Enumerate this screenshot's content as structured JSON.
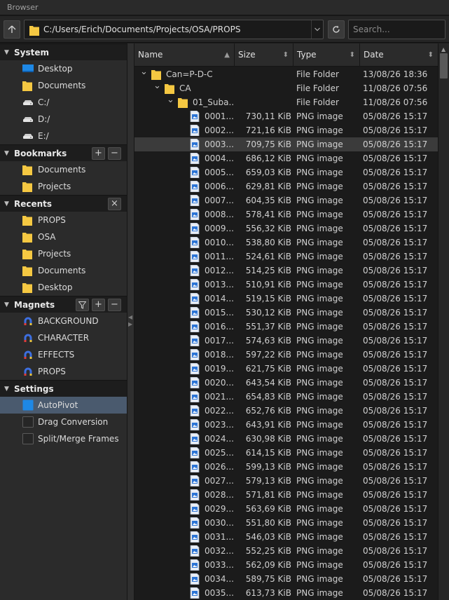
{
  "window": {
    "title": "Browser"
  },
  "toolbar": {
    "path": "C:/Users/Erich/Documents/Projects/OSA/PROPS",
    "search_placeholder": "Search..."
  },
  "sidebar": {
    "sections": [
      {
        "title": "System",
        "buttons": [],
        "items": [
          {
            "label": "Desktop",
            "icon": "desktop-icon"
          },
          {
            "label": "Documents",
            "icon": "folder-icon"
          },
          {
            "label": "C:/",
            "icon": "drive-icon"
          },
          {
            "label": "D:/",
            "icon": "drive-icon"
          },
          {
            "label": "E:/",
            "icon": "drive-icon"
          }
        ]
      },
      {
        "title": "Bookmarks",
        "buttons": [
          "+",
          "−"
        ],
        "items": [
          {
            "label": "Documents",
            "icon": "folder-icon"
          },
          {
            "label": "Projects",
            "icon": "folder-icon"
          }
        ]
      },
      {
        "title": "Recents",
        "buttons": [
          "×"
        ],
        "items": [
          {
            "label": "PROPS",
            "icon": "folder-icon"
          },
          {
            "label": "OSA",
            "icon": "folder-icon"
          },
          {
            "label": "Projects",
            "icon": "folder-icon"
          },
          {
            "label": "Documents",
            "icon": "folder-icon"
          },
          {
            "label": "Desktop",
            "icon": "folder-icon"
          }
        ]
      },
      {
        "title": "Magnets",
        "buttons": [
          "filter",
          "+",
          "−"
        ],
        "items": [
          {
            "label": "BACKGROUND",
            "icon": "magnet-icon"
          },
          {
            "label": "CHARACTER",
            "icon": "magnet-icon"
          },
          {
            "label": "EFFECTS",
            "icon": "magnet-icon"
          },
          {
            "label": "PROPS",
            "icon": "magnet-icon"
          }
        ]
      },
      {
        "title": "Settings",
        "buttons": [],
        "items": [
          {
            "label": "AutoPivot",
            "icon": "checkbox-icon",
            "checked": true,
            "selected": true
          },
          {
            "label": "Drag Conversion",
            "icon": "checkbox-icon",
            "checked": false
          },
          {
            "label": "Split/Merge Frames",
            "icon": "checkbox-icon",
            "checked": false
          }
        ]
      }
    ]
  },
  "columns": [
    {
      "label": "Name"
    },
    {
      "label": "Size"
    },
    {
      "label": "Type"
    },
    {
      "label": "Date"
    }
  ],
  "tree": [
    {
      "name": "Can=P-D-C",
      "size": "",
      "type": "File Folder",
      "date": "13/08/26 18:36",
      "level": 0,
      "icon": "folder-icon",
      "expanded": true
    },
    {
      "name": "CA",
      "size": "",
      "type": "File Folder",
      "date": "11/08/26 07:56",
      "level": 1,
      "icon": "folder-icon",
      "expanded": true
    },
    {
      "name": "01_Suba...",
      "size": "",
      "type": "File Folder",
      "date": "11/08/26 07:56",
      "level": 2,
      "icon": "folder-icon",
      "expanded": true
    }
  ],
  "files": [
    {
      "name": "0001...",
      "size": "730,11 KiB"
    },
    {
      "name": "0002...",
      "size": "721,16 KiB"
    },
    {
      "name": "0003...",
      "size": "709,75 KiB",
      "selected": true
    },
    {
      "name": "0004...",
      "size": "686,12 KiB"
    },
    {
      "name": "0005...",
      "size": "659,03 KiB"
    },
    {
      "name": "0006...",
      "size": "629,81 KiB"
    },
    {
      "name": "0007...",
      "size": "604,35 KiB"
    },
    {
      "name": "0008...",
      "size": "578,41 KiB"
    },
    {
      "name": "0009...",
      "size": "556,32 KiB"
    },
    {
      "name": "0010...",
      "size": "538,80 KiB"
    },
    {
      "name": "0011...",
      "size": "524,61 KiB"
    },
    {
      "name": "0012...",
      "size": "514,25 KiB"
    },
    {
      "name": "0013...",
      "size": "510,91 KiB"
    },
    {
      "name": "0014...",
      "size": "519,15 KiB"
    },
    {
      "name": "0015...",
      "size": "530,12 KiB"
    },
    {
      "name": "0016...",
      "size": "551,37 KiB"
    },
    {
      "name": "0017...",
      "size": "574,63 KiB"
    },
    {
      "name": "0018...",
      "size": "597,22 KiB"
    },
    {
      "name": "0019...",
      "size": "621,75 KiB"
    },
    {
      "name": "0020...",
      "size": "643,54 KiB"
    },
    {
      "name": "0021...",
      "size": "654,83 KiB"
    },
    {
      "name": "0022...",
      "size": "652,76 KiB"
    },
    {
      "name": "0023...",
      "size": "643,91 KiB"
    },
    {
      "name": "0024...",
      "size": "630,98 KiB"
    },
    {
      "name": "0025...",
      "size": "614,15 KiB"
    },
    {
      "name": "0026...",
      "size": "599,13 KiB"
    },
    {
      "name": "0027...",
      "size": "579,13 KiB"
    },
    {
      "name": "0028...",
      "size": "571,81 KiB"
    },
    {
      "name": "0029...",
      "size": "563,69 KiB"
    },
    {
      "name": "0030...",
      "size": "551,80 KiB"
    },
    {
      "name": "0031...",
      "size": "546,03 KiB"
    },
    {
      "name": "0032...",
      "size": "552,25 KiB"
    },
    {
      "name": "0033...",
      "size": "562,09 KiB"
    },
    {
      "name": "0034...",
      "size": "589,75 KiB"
    },
    {
      "name": "0035...",
      "size": "613,73 KiB"
    }
  ],
  "file_defaults": {
    "type": "PNG image",
    "date": "05/08/26 15:17"
  },
  "colors": {
    "folder": "#f5c842",
    "selection": "#4a5a6e",
    "row_selected": "#3b3b3b",
    "accent": "#1e88e5"
  }
}
